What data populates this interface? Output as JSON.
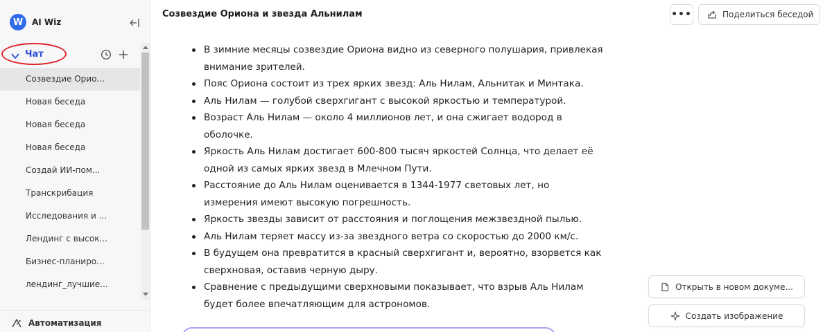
{
  "brand": {
    "logo_letter": "W",
    "name": "AI Wiz"
  },
  "sidebar": {
    "chat_section_label": "Чат",
    "chats": [
      {
        "label": "Созвездие Орио...",
        "active": true
      },
      {
        "label": "Новая беседа",
        "active": false
      },
      {
        "label": "Новая беседа",
        "active": false
      },
      {
        "label": "Новая беседа",
        "active": false
      },
      {
        "label": "Создай ИИ-пом...",
        "active": false
      },
      {
        "label": "Транскрибация",
        "active": false
      },
      {
        "label": "Исследования и ...",
        "active": false
      },
      {
        "label": "Лендинг с высок...",
        "active": false
      },
      {
        "label": "Бизнес-планиро...",
        "active": false
      },
      {
        "label": "лендинг_лучшие...",
        "active": false
      }
    ],
    "automation_label": "Автоматизация"
  },
  "header": {
    "title": "Созвездие Ориона и звезда Альнилам",
    "more_label": "•••",
    "share_label": "Поделиться беседой"
  },
  "content": {
    "bullets": [
      "В зимние месяцы созвездие Ориона видно из северного полушария, привлекая внимание зрителей.",
      "Пояс Ориона состоит из трех ярких звезд: Аль Нилам, Альнитак и Минтака.",
      "Аль Нилам — голубой сверхгигант с высокой яркостью и температурой.",
      "Возраст Аль Нилам — около 4 миллионов лет, и она сжигает водород в оболочке.",
      "Яркость Аль Нилам достигает 600-800 тысяч яркостей Солнца, что делает её одной из самых ярких звезд в Млечном Пути.",
      "Расстояние до Аль Нилам оценивается в 1344-1977 световых лет, но измерения имеют высокую погрешность.",
      "Яркость звезды зависит от расстояния и поглощения межзвездной пылью.",
      "Аль Нилам теряет массу из-за звездного ветра со скоростью до 2000 км/с.",
      "В будущем она превратится в красный сверхгигант и, вероятно, взорвется как сверхновая, оставив черную дыру.",
      "Сравнение с предыдущими сверхновыми показывает, что взрыв Аль Нилам будет более впечатляющим для астрономов."
    ]
  },
  "actions": {
    "open_doc_label": "Открыть в новом докуме...",
    "create_image_label": "Создать изображение"
  },
  "colors": {
    "accent": "#2f4fd8",
    "annotation_circle": "#e0222a",
    "brand": "#2f6bea"
  }
}
